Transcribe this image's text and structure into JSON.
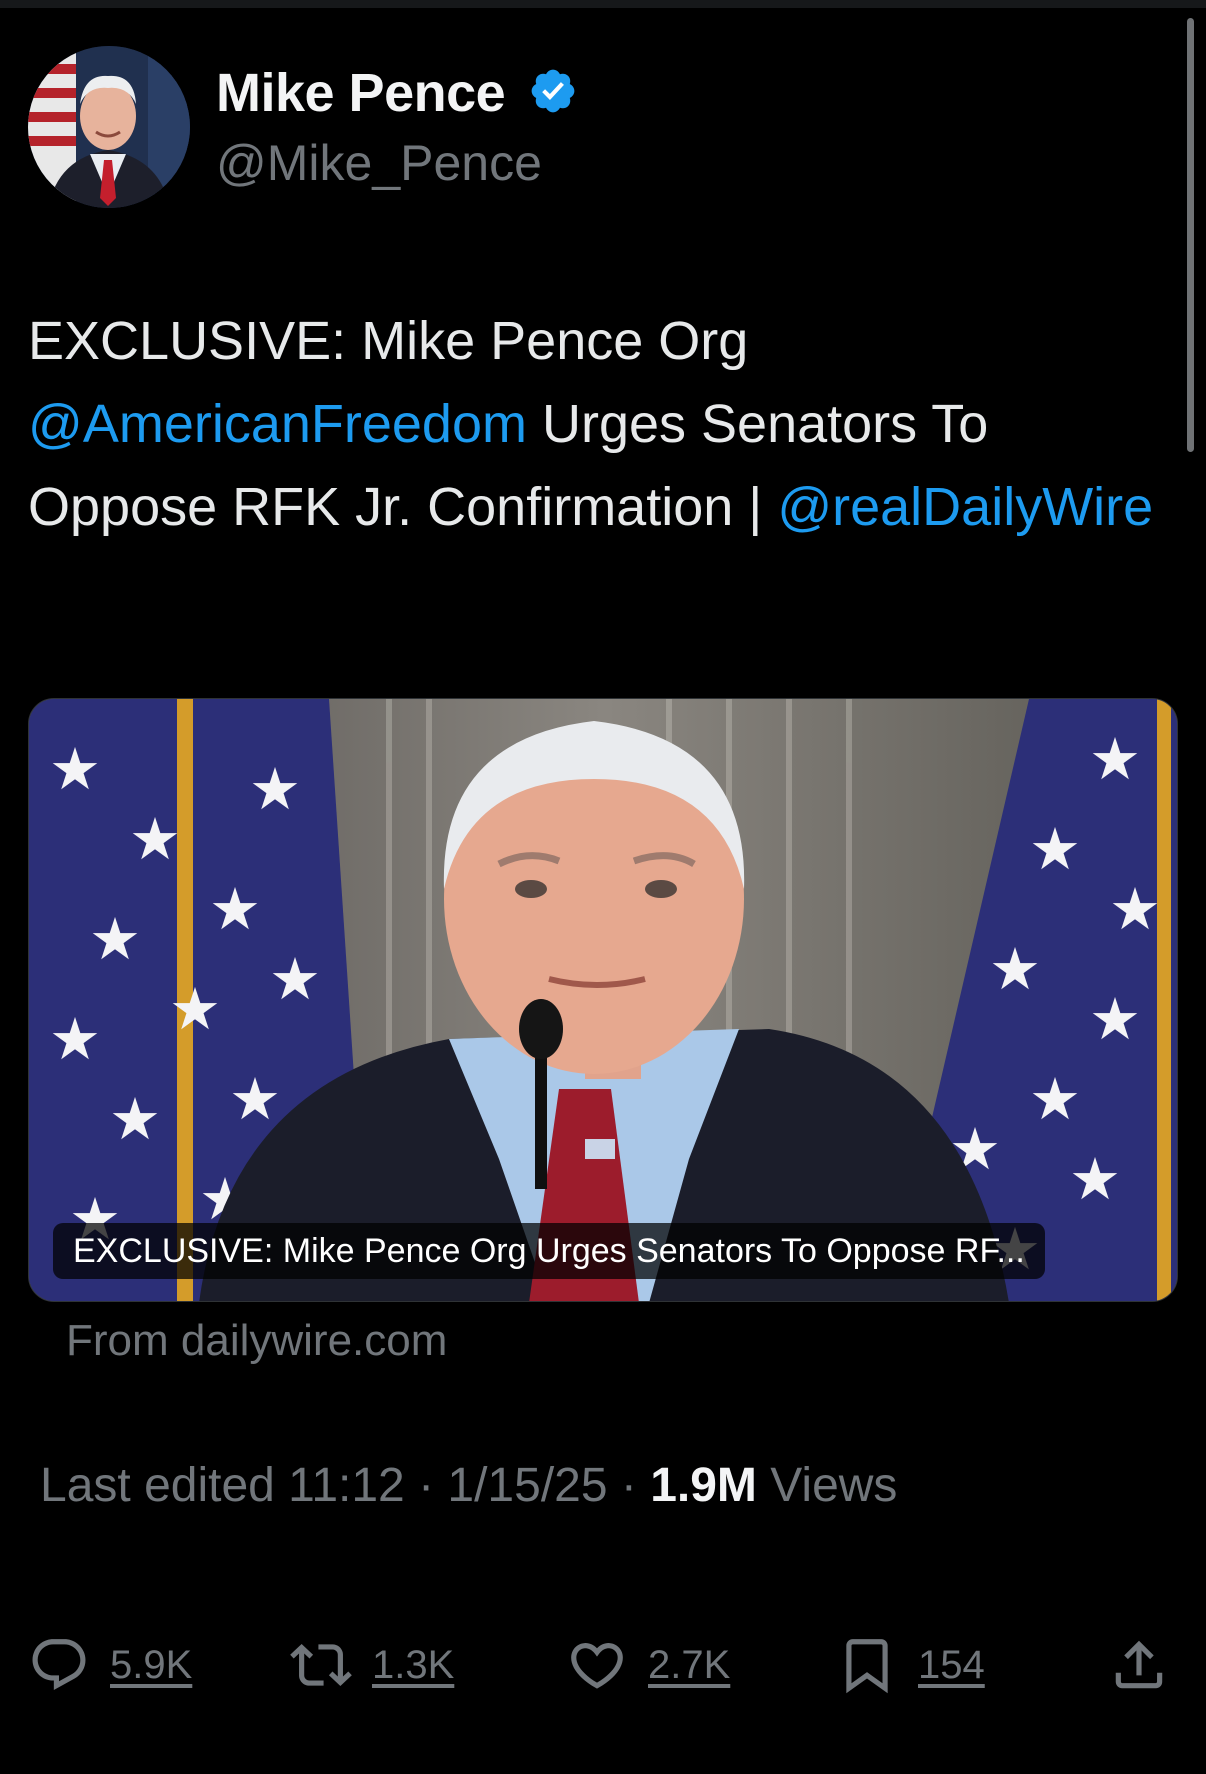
{
  "author": {
    "display_name": "Mike Pence",
    "handle": "@Mike_Pence",
    "verified": true,
    "avatar_icon": "avatar-portrait"
  },
  "tweet": {
    "text_parts": [
      {
        "type": "text",
        "value": "EXCLUSIVE: Mike Pence Org "
      },
      {
        "type": "mention",
        "value": "@AmericanFreedom"
      },
      {
        "type": "text",
        "value": " Urges Senators To Oppose RFK Jr. Confirmation | "
      },
      {
        "type": "mention",
        "value": "@realDailyWire"
      }
    ]
  },
  "card": {
    "caption": "EXCLUSIVE: Mike Pence Org Urges Senators To Oppose RF...",
    "source": "From dailywire.com"
  },
  "meta": {
    "edited_label": "Last edited 11:12 · 1/15/25",
    "separator": " · ",
    "views_count": "1.9M",
    "views_label": " Views"
  },
  "actions": {
    "replies": "5.9K",
    "reposts": "1.3K",
    "likes": "2.7K",
    "bookmarks": "154"
  },
  "colors": {
    "background": "#000000",
    "text": "#e7e9ea",
    "secondary": "#71767b",
    "accent": "#1d9bf0"
  }
}
